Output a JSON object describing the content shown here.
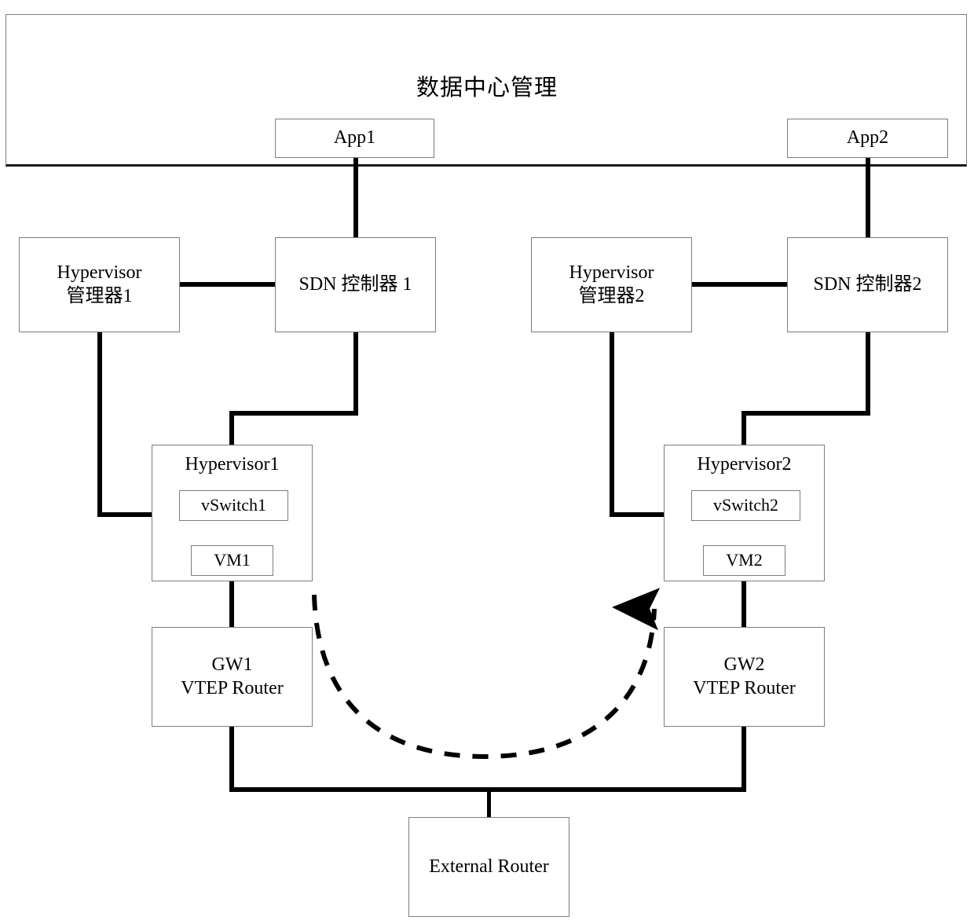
{
  "diagram": {
    "title": "数据中心管理",
    "type": "network-architecture-diagram"
  },
  "management_frame": {
    "title": "数据中心管理",
    "apps": [
      {
        "id": "app1",
        "label": "App1"
      },
      {
        "id": "app2",
        "label": "App2"
      }
    ]
  },
  "site_left": {
    "hypervisor_manager": {
      "line1": "Hypervisor",
      "line2": "管理器1"
    },
    "sdn_controller": {
      "label": "SDN 控制器 1"
    },
    "hypervisor": {
      "label": "Hypervisor1",
      "vswitch": {
        "label": "vSwitch1"
      },
      "vm": {
        "label": "VM1"
      }
    },
    "gateway": {
      "line1": "GW1",
      "line2": "VTEP Router"
    }
  },
  "site_right": {
    "hypervisor_manager": {
      "line1": "Hypervisor",
      "line2": "管理器2"
    },
    "sdn_controller": {
      "label": "SDN 控制器2"
    },
    "hypervisor": {
      "label": "Hypervisor2",
      "vswitch": {
        "label": "vSwitch2"
      },
      "vm": {
        "label": "VM2"
      }
    },
    "gateway": {
      "line1": "GW2",
      "line2": "VTEP Router"
    }
  },
  "external": {
    "router": {
      "label": "External Router"
    }
  },
  "flows": {
    "tunnel_arrow": {
      "name": "vxlan-tunnel-arrow",
      "style": "dashed",
      "direction": "left-to-right",
      "from": "GW1 VTEP Router",
      "to": "GW2 VTEP Router"
    }
  },
  "colors": {
    "line": "#000000",
    "box_border": "#7d7d7d",
    "background": "#ffffff"
  }
}
